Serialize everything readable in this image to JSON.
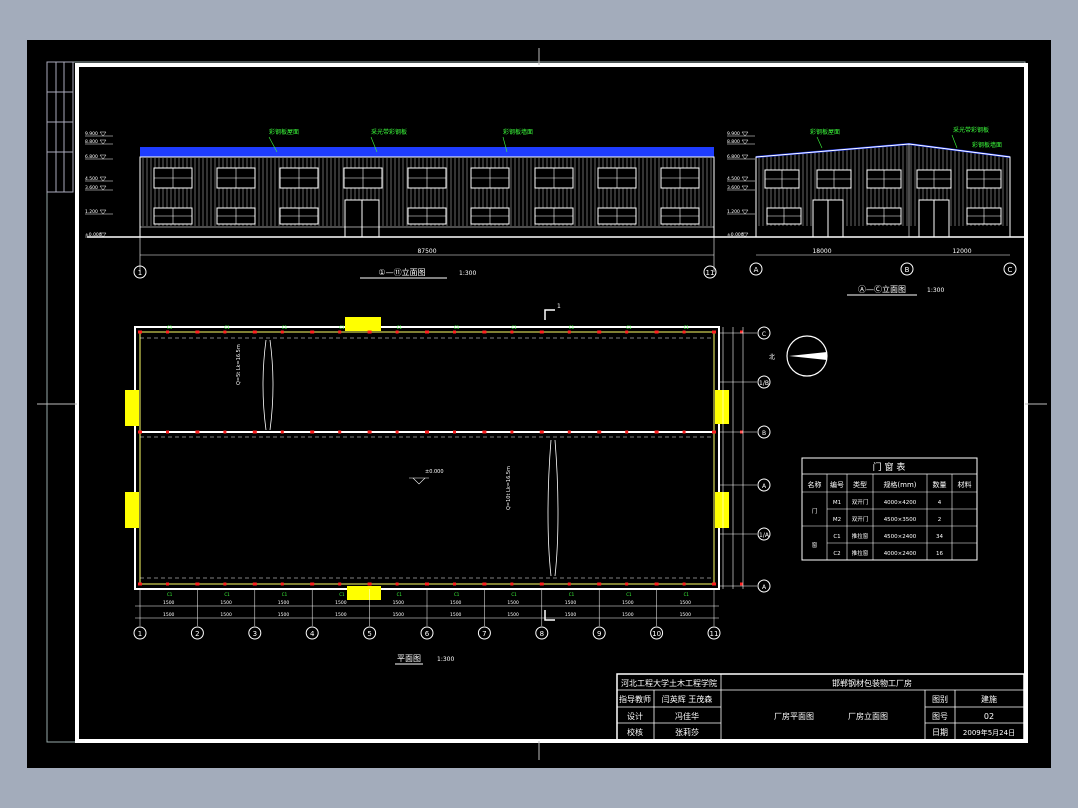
{
  "colors": {
    "background": "#a3acbb",
    "sheet": "#000000",
    "frame": "#ffffff",
    "structure": "#ffffff",
    "roof": "#1e3cff",
    "annotation": "#3cff3c",
    "cyan": "#00ffff",
    "door_highlight": "#ffff00",
    "marker": "#ff2020"
  },
  "elevation_1": {
    "label_roof": "彩钢板屋面",
    "label_skylight": "采光带彩钢板",
    "label_wall": "彩钢板墙面",
    "dimension_total": "87500",
    "title": "①—⑪立面图",
    "scale": "1:300",
    "axis_start": "1",
    "axis_end": "11",
    "levels": [
      "9.900",
      "8.800",
      "6.800",
      "4.500",
      "3.600",
      "1.200",
      "±0.000"
    ]
  },
  "elevation_2": {
    "label_roof": "彩钢板屋面",
    "label_skylight": "采光带彩钢板",
    "label_wall": "彩钢板墙面",
    "dimension_left": "18000",
    "dimension_right": "12000",
    "title": "Ⓐ—Ⓒ立面图",
    "scale": "1:300",
    "axes": [
      "A",
      "B",
      "C"
    ],
    "levels": [
      "9.900",
      "8.800",
      "6.800",
      "4.500",
      "3.600",
      "1.200",
      "±0.000"
    ]
  },
  "plan": {
    "title": "平面图",
    "scale": "1:300",
    "elevation_mark": "±0.000",
    "section_mark": "1",
    "column_axes": [
      "1",
      "2",
      "3",
      "4",
      "5",
      "6",
      "7",
      "8",
      "9",
      "10",
      "11"
    ],
    "row_axes": [
      "C",
      "1/B",
      "B",
      "A",
      "1/A",
      "A"
    ],
    "bay_dims": [
      "1500",
      "1500",
      "1500",
      "1500",
      "1500",
      "1500",
      "1500",
      "1500",
      "1500",
      "1500"
    ],
    "crane_label_1": "Q=5t  Lk=16.5m",
    "crane_label_2": "Q=10t  Lk=16.5m",
    "door_labels": [
      "M1",
      "M2"
    ],
    "window_labels": [
      "C1",
      "C2"
    ]
  },
  "schedule": {
    "title": "门 窗 表",
    "headers": [
      "名称",
      "编号",
      "类型",
      "规格(mm)",
      "数量",
      "材料"
    ],
    "rows": [
      [
        "门",
        "M1",
        "双开门",
        "4000×4200",
        "4",
        ""
      ],
      [
        "",
        "M2",
        "双开门",
        "4500×3500",
        "2",
        ""
      ],
      [
        "窗",
        "C1",
        "推拉窗",
        "4500×2400",
        "34",
        ""
      ],
      [
        "",
        "C2",
        "推拉窗",
        "4000×2400",
        "16",
        ""
      ]
    ]
  },
  "title_block": {
    "school": "河北工程大学土木工程学院",
    "project": "邯郸钢材包装物工厂房",
    "advisor_label": "指导教师",
    "advisors": "闫英辉 王茂森",
    "designer_label": "设计",
    "designer": "冯佳华",
    "checker_label": "校核",
    "checker": "张莉莎",
    "drawing_names": [
      "厂房平面图",
      "厂房立面图"
    ],
    "category_label": "图别",
    "category": "建施",
    "number_label": "图号",
    "number": "02",
    "date_label": "日期",
    "date": "2009年5月24日"
  }
}
